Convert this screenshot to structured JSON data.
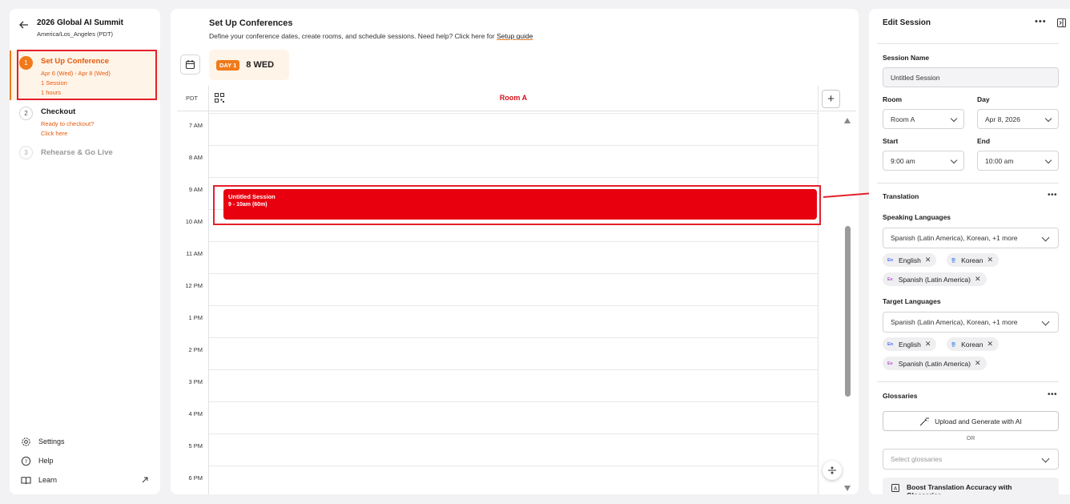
{
  "sidebar": {
    "event_title": "2026 Global AI Summit",
    "timezone": "America/Los_Angeles (PDT)",
    "steps": [
      {
        "num": "1",
        "label": "Set Up Conference",
        "sub": [
          "Apr 6 (Wed) - Apr 8 (Wed)",
          "1 Session",
          "1 hours"
        ]
      },
      {
        "num": "2",
        "label": "Checkout",
        "sub": [
          "Ready to checkout?",
          "Click here"
        ]
      },
      {
        "num": "3",
        "label": "Rehearse & Go Live",
        "sub": []
      }
    ],
    "bottom": [
      {
        "label": "Settings",
        "icon": "gear-icon"
      },
      {
        "label": "Help",
        "icon": "help-circle-icon"
      },
      {
        "label": "Learn",
        "icon": "book-icon"
      }
    ]
  },
  "main": {
    "title": "Set Up Conferences",
    "description": "Define your conference dates, create rooms, and schedule sessions. Need help? Click here for",
    "guide_link": "Setup guide",
    "day_badge": "DAY 1",
    "day_name": "8 WED",
    "tz_short": "PDT",
    "room": "Room A",
    "hours": [
      "7 AM",
      "8 AM",
      "9 AM",
      "10 AM",
      "11 AM",
      "12 PM",
      "1 PM",
      "2 PM",
      "3 PM",
      "4 PM",
      "5 PM",
      "6 PM"
    ],
    "session": {
      "title": "Untitled Session",
      "time": "9 - 10am (60m)"
    }
  },
  "panel": {
    "title": "Edit Session",
    "session_name_label": "Session Name",
    "session_name_value": "Untitled Session",
    "room_label": "Room",
    "room_value": "Room A",
    "day_label": "Day",
    "day_value": "Apr 8, 2026",
    "start_label": "Start",
    "start_value": "9:00 am",
    "end_label": "End",
    "end_value": "10:00 am",
    "translation_title": "Translation",
    "speaking_label": "Speaking Languages",
    "speaking_value": "Spanish (Latin America), Korean, +1 more",
    "speaking_chips": [
      {
        "icon": "En",
        "label": "English",
        "color": "#4a6cf7"
      },
      {
        "icon": "한",
        "label": "Korean",
        "color": "#3b7ddd"
      },
      {
        "icon": "Es",
        "label": "Spanish (Latin America)",
        "color": "#c04fd0"
      }
    ],
    "target_label": "Target Languages",
    "target_value": "Spanish (Latin America), Korean, +1 more",
    "target_chips": [
      {
        "icon": "En",
        "label": "English",
        "color": "#4a6cf7"
      },
      {
        "icon": "한",
        "label": "Korean",
        "color": "#3b7ddd"
      },
      {
        "icon": "Es",
        "label": "Spanish (Latin America)",
        "color": "#c04fd0"
      }
    ],
    "glossaries_title": "Glossaries",
    "upload_label": "Upload and Generate with AI",
    "or_label": "OR",
    "select_glossaries_placeholder": "Select glossaries",
    "boost_label": "Boost Translation Accuracy with Glossaries"
  },
  "colors": {
    "accent": "#f07a1a",
    "session": "#e8000f",
    "annotation": "#e5202b"
  }
}
